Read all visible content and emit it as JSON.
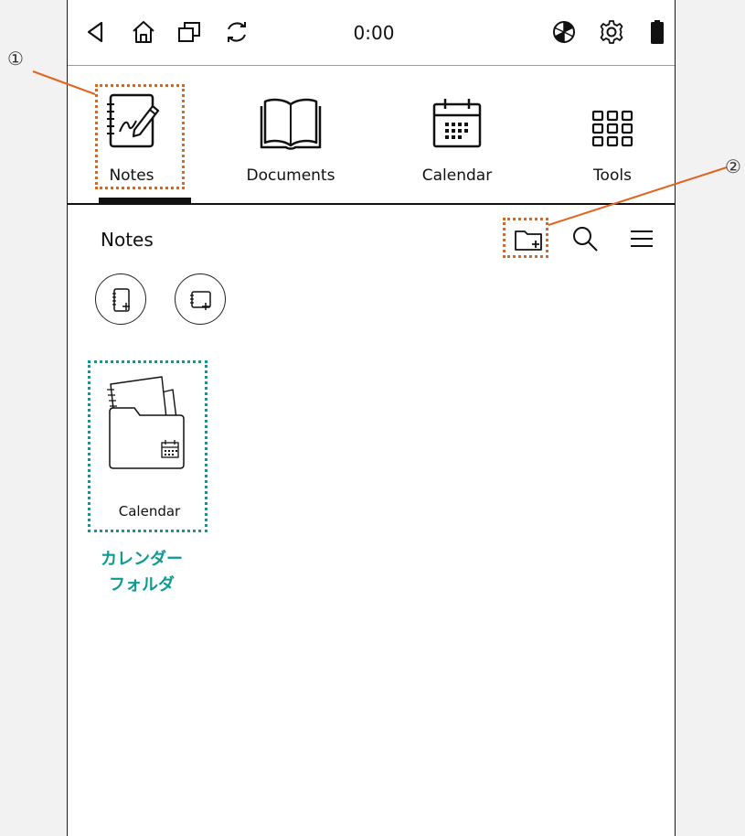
{
  "status_bar": {
    "time": "0:00",
    "left_icons": [
      "back-triangle-icon",
      "home-icon",
      "recent-apps-icon",
      "sync-icon"
    ],
    "right_icons": [
      "aperture-icon",
      "settings-gear-icon",
      "battery-icon"
    ]
  },
  "nav": {
    "items": [
      {
        "label": "Notes",
        "icon": "notebook-pen-icon",
        "selected": true
      },
      {
        "label": "Documents",
        "icon": "open-book-icon",
        "selected": false
      },
      {
        "label": "Calendar",
        "icon": "calendar-icon",
        "selected": false
      },
      {
        "label": "Tools",
        "icon": "grid-icon",
        "selected": false
      }
    ]
  },
  "notes_view": {
    "title": "Notes",
    "toolbar_icons": [
      "new-folder-icon",
      "search-icon",
      "menu-icon"
    ],
    "create_buttons": [
      "new-note-icon",
      "new-note-from-template-icon"
    ],
    "folders": [
      {
        "label": "Calendar",
        "icon": "folder-with-calendar-icon"
      }
    ]
  },
  "annotations": {
    "marker_1": "①",
    "marker_2": "②",
    "caption": "カレンダー\nフォルダ"
  },
  "colors": {
    "annotation_orange": "#e0641e",
    "annotation_teal": "#0d9a91",
    "ink": "#111111"
  }
}
